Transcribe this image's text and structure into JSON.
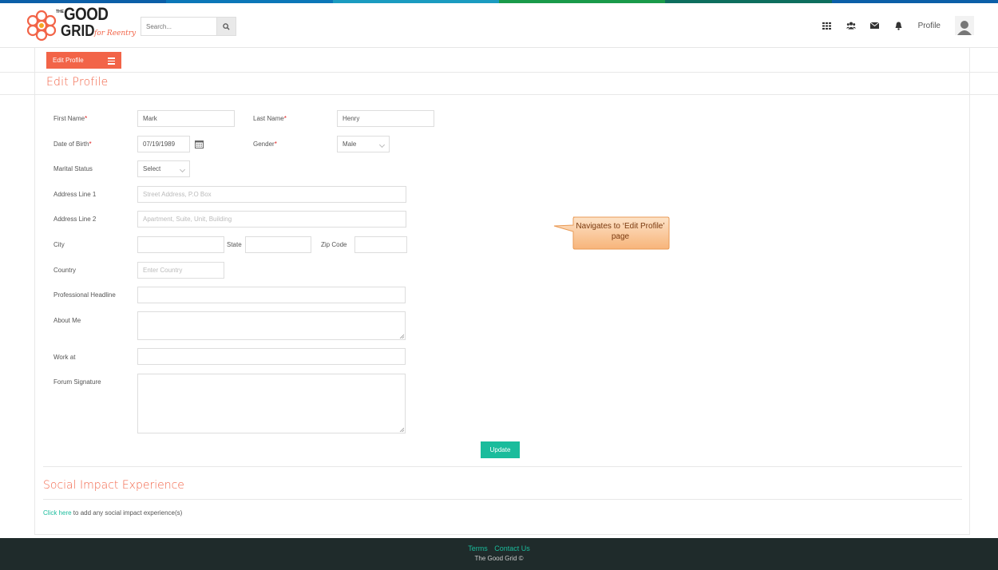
{
  "colors": {
    "accent": "#f26448",
    "teal": "#1abc9c",
    "footer_bg": "#1f2b2b",
    "topbar": [
      "#0b5fa8",
      "#0b77b8",
      "#1b9bc0",
      "#1a9a4a",
      "#0e6e5e",
      "#0b5fa8"
    ]
  },
  "header": {
    "logo": {
      "line1": "THE",
      "line2": "GOOD",
      "line3": "GRID",
      "tagline": "for Reentry"
    },
    "search": {
      "placeholder": "Search..."
    },
    "nav": {
      "profile_label": "Profile"
    },
    "icons": [
      "apps-grid-icon",
      "users-icon",
      "envelope-icon",
      "bell-icon",
      "user-avatar-icon",
      "search-icon"
    ]
  },
  "toolbar": {
    "edit_profile_label": "Edit Profile"
  },
  "page": {
    "title": "Edit Profile"
  },
  "form": {
    "first_name": {
      "label": "First Name",
      "required": "*",
      "value": "Mark"
    },
    "last_name": {
      "label": "Last Name",
      "required": "*",
      "value": "Henry"
    },
    "dob": {
      "label": "Date of Birth",
      "required": "*",
      "value": "07/19/1989"
    },
    "gender": {
      "label": "Gender",
      "required": "*",
      "value": "Male"
    },
    "marital": {
      "label": "Marital Status",
      "value": "Select"
    },
    "address1": {
      "label": "Address Line 1",
      "placeholder": "Street Address, P.O Box"
    },
    "address2": {
      "label": "Address Line 2",
      "placeholder": "Apartment, Suite, Unit, Building"
    },
    "city": {
      "label": "City"
    },
    "state": {
      "label": "State"
    },
    "zip": {
      "label": "Zip Code"
    },
    "country": {
      "label": "Country",
      "placeholder": "Enter Country"
    },
    "headline": {
      "label": "Professional Headline"
    },
    "about": {
      "label": "About Me"
    },
    "work": {
      "label": "Work at"
    },
    "signature": {
      "label": "Forum Signature"
    },
    "update_label": "Update"
  },
  "callout": {
    "text": "Navigates to ‘Edit Profile’ page"
  },
  "social": {
    "title": "Social Impact Experience",
    "link_text": "Click here",
    "rest_text": " to add any social impact experience(s)"
  },
  "footer": {
    "terms": "Terms",
    "contact": "Contact Us",
    "copyright": "The Good Grid ©"
  }
}
